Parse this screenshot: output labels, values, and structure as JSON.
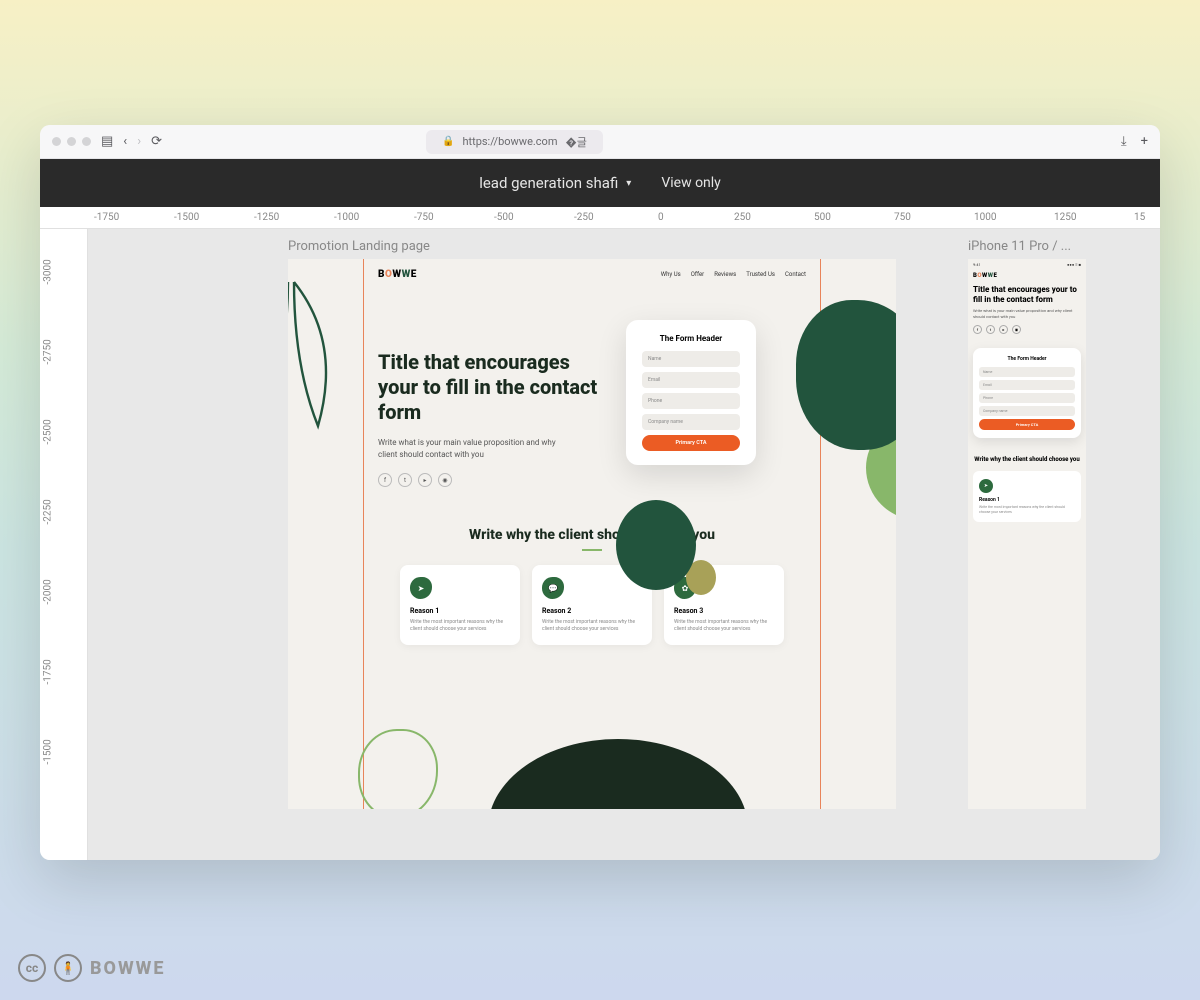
{
  "browser": {
    "url": "https://bowwe.com"
  },
  "header": {
    "title": "lead generation shafi",
    "view_only": "View only"
  },
  "ruler_h": [
    "-1750",
    "-1500",
    "-1250",
    "-1000",
    "-750",
    "-500",
    "-250",
    "0",
    "250",
    "500",
    "750",
    "1000",
    "1250",
    "15"
  ],
  "ruler_v": [
    "-3000",
    "-2750",
    "-2500",
    "-2250",
    "-2000",
    "-1750",
    "-1500"
  ],
  "frames": {
    "desktop_label": "Promotion Landing page",
    "mobile_label": "iPhone 11 Pro / ..."
  },
  "page": {
    "logo": "BOWWE",
    "nav": [
      "Why Us",
      "Offer",
      "Reviews",
      "Trusted Us",
      "Contact"
    ],
    "hero_title": "Title that encourages your to fill in the contact form",
    "hero_sub": "Write what is your main value proposition and why client should contact with you",
    "form": {
      "header": "The Form Header",
      "fields": [
        "Name",
        "Email",
        "Phone",
        "Company name"
      ],
      "cta": "Primary CTA"
    },
    "section2_title": "Write why the client should choose you",
    "reasons": [
      {
        "title": "Reason 1",
        "body": "Write the most important reasons why the client should choose your services"
      },
      {
        "title": "Reason 2",
        "body": "Write the most important reasons why the client should choose your services"
      },
      {
        "title": "Reason 3",
        "body": "Write the most important reasons why the client should choose your services"
      }
    ]
  },
  "mobile": {
    "status_time": "9:41",
    "section2_title": "Write why the client should choose you"
  },
  "watermark": "BOWWE"
}
